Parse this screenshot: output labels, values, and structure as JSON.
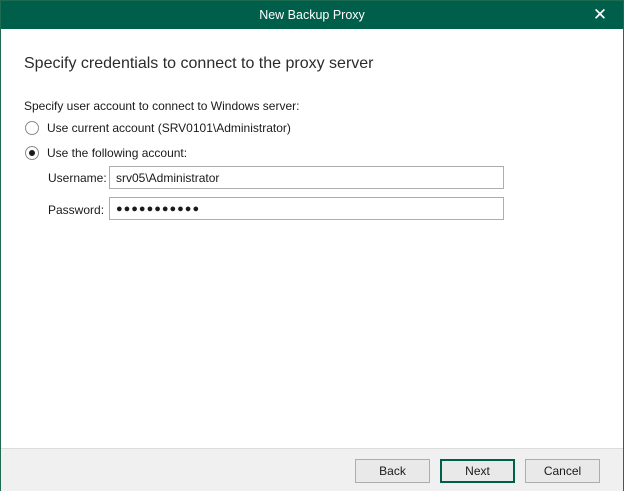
{
  "window": {
    "title": "New Backup Proxy",
    "close_icon": "close-icon"
  },
  "page": {
    "heading": "Specify credentials to connect to the proxy server",
    "group_label": "Specify user account to connect to Windows server:"
  },
  "options": {
    "current_account_label": "Use current account (SRV0101\\Administrator)",
    "following_account_label": "Use the following account:",
    "selected": "following"
  },
  "credentials": {
    "username_label": "Username:",
    "username_value": "srv05\\Administrator",
    "password_label": "Password:",
    "password_value": "●●●●●●●●●●●"
  },
  "buttons": {
    "back": "Back",
    "next": "Next",
    "cancel": "Cancel"
  },
  "colors": {
    "titlebar": "#005f4b",
    "accent_border": "#005f4b"
  }
}
